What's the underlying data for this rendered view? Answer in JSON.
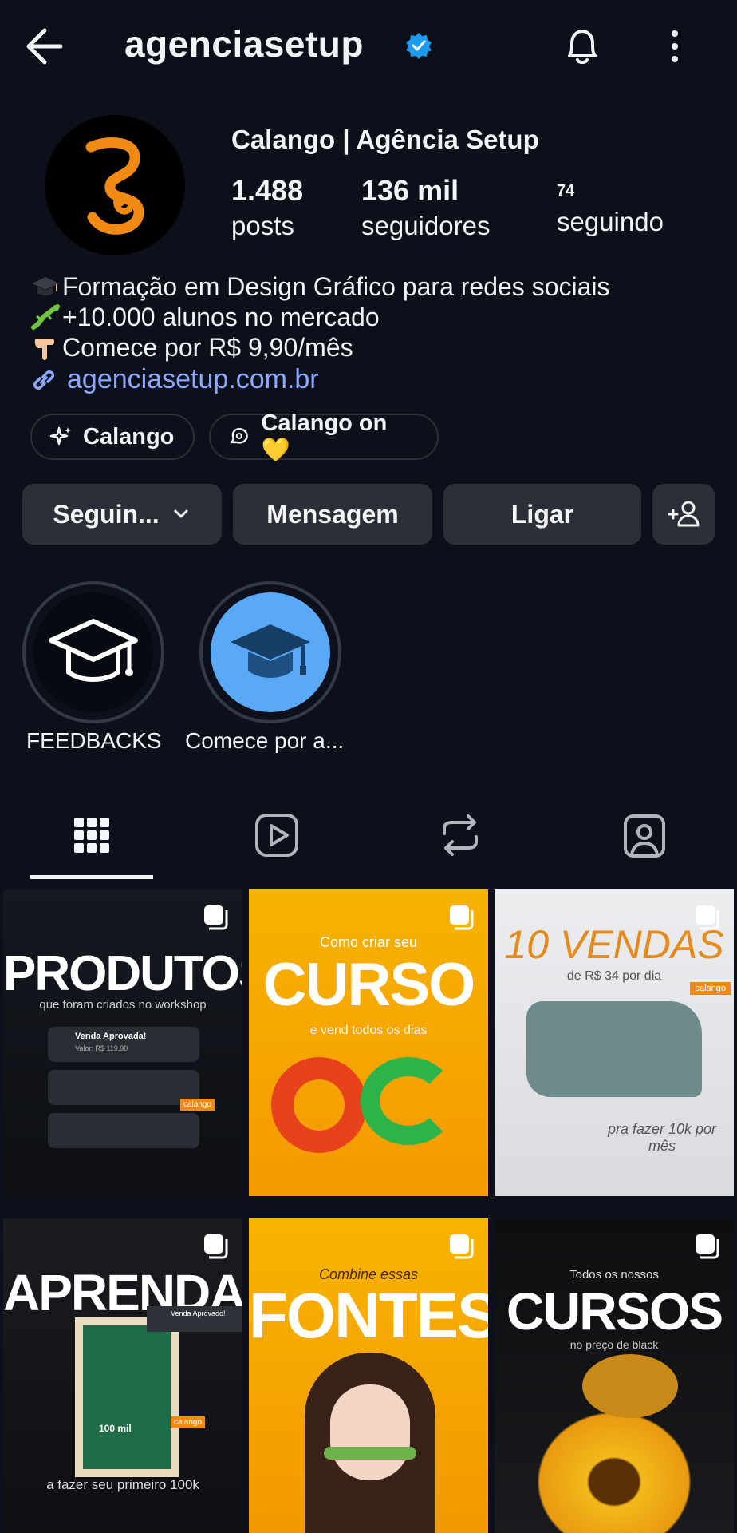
{
  "header": {
    "username": "agenciasetup",
    "icons": [
      "back-arrow-icon",
      "verified-badge-icon",
      "bell-icon",
      "more-vertical-icon"
    ]
  },
  "profile": {
    "display_name": "Calango | Agência Setup",
    "posts_count": "1.488",
    "posts_label": "posts",
    "followers_count": "136 mil",
    "followers_label": "seguidores",
    "following_count": "74",
    "following_label": "seguindo",
    "bio": [
      "Formação em Design Gráfico para redes sociais",
      "+10.000 alunos no mercado",
      " Comece por R$ 9,90/mês"
    ],
    "link": "agenciasetup.com.br"
  },
  "chips": [
    {
      "label": "Calango",
      "icon": "sparkles-icon"
    },
    {
      "label": "Calango on 💛",
      "icon": "threads-chat-icon"
    }
  ],
  "actions": {
    "following_label": "Seguin...",
    "message_label": "Mensagem",
    "call_label": "Ligar",
    "suggest_icon": "add-person-icon"
  },
  "highlights": [
    {
      "label": "FEEDBACKS",
      "icon": "graduation-cap-icon"
    },
    {
      "label": "Comece por a...",
      "icon": "graduation-cap-icon"
    }
  ],
  "tabs": [
    "grid-icon",
    "reels-icon",
    "reposts-icon",
    "tagged-icon"
  ],
  "posts": [
    {
      "big": "PRODUTOS",
      "small": "que foram criados no workshop",
      "extra": "Venda Aprovada!",
      "extra2": "Valor: R$ 119,90",
      "tag": "calango"
    },
    {
      "big": "CURSO",
      "small": "Como criar seu",
      "extra": "e vend   todos os dias"
    },
    {
      "big": "10 VENDAS",
      "small": "de R$ 34 por dia",
      "tag": "calango",
      "extra": "pra fazer 10k por mês"
    },
    {
      "big": "APRENDA",
      "small": "a fazer seu primeiro 100k",
      "extra": "Venda Aprovado!",
      "tag": "calango",
      "extra2": "100 mil"
    },
    {
      "big": "FONTES",
      "small": "Combine essas"
    },
    {
      "big": "CURSOS",
      "small": "Todos os nossos",
      "extra": "no preço de black"
    }
  ],
  "colors": {
    "background": "#0b101a",
    "button": "#2a2f38",
    "link": "#8ba7ff",
    "verified": "#1d9bf0",
    "accent_orange": "#f08a12"
  }
}
